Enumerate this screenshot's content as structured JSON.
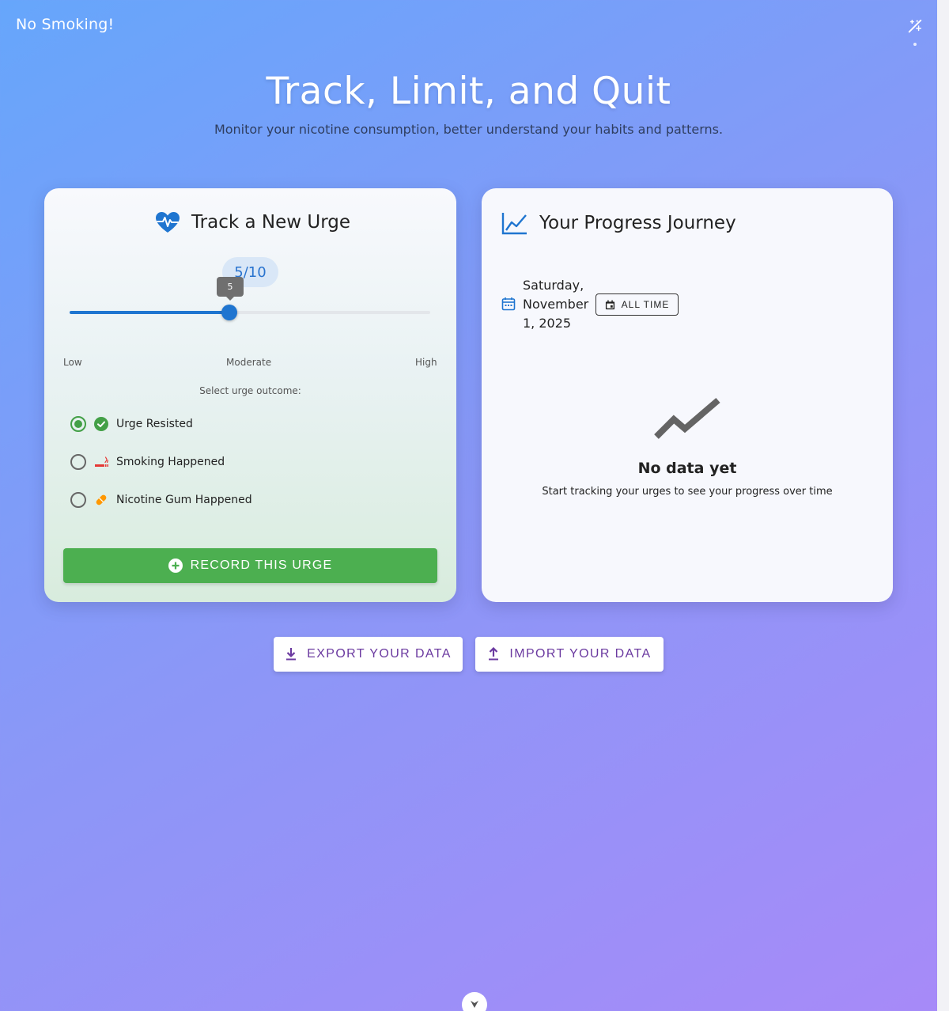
{
  "app": {
    "title": "No Smoking!"
  },
  "hero": {
    "title": "Track, Limit, and Quit",
    "subtitle": "Monitor your nicotine consumption, better understand your habits and patterns."
  },
  "track_card": {
    "title": "Track a New Urge",
    "icon": "heart-pulse-icon",
    "slider": {
      "value": 5,
      "max": 10,
      "display": "5/10",
      "tooltip": "5"
    },
    "scale": {
      "low": "Low",
      "moderate": "Moderate",
      "high": "High"
    },
    "outcome_caption": "Select urge outcome:",
    "outcomes": [
      {
        "label": "Urge Resisted",
        "icon": "check-circle-icon",
        "selected": true
      },
      {
        "label": "Smoking Happened",
        "icon": "smoking-icon",
        "selected": false
      },
      {
        "label": "Nicotine Gum Happened",
        "icon": "pill-icon",
        "selected": false
      }
    ],
    "record_button": "RECORD THIS URGE"
  },
  "progress_card": {
    "title": "Your Progress Journey",
    "icon": "chart-line-icon",
    "date": "Saturday, November 1, 2025",
    "all_time_button": "ALL TIME",
    "empty_title": "No data yet",
    "empty_subtitle": "Start tracking your urges to see your progress over time"
  },
  "actions": {
    "export_label": "EXPORT YOUR DATA",
    "import_label": "IMPORT YOUR DATA"
  },
  "colors": {
    "accent_blue": "#1f75d0",
    "green": "#4caf50",
    "purple_text": "#6b3aa0"
  }
}
